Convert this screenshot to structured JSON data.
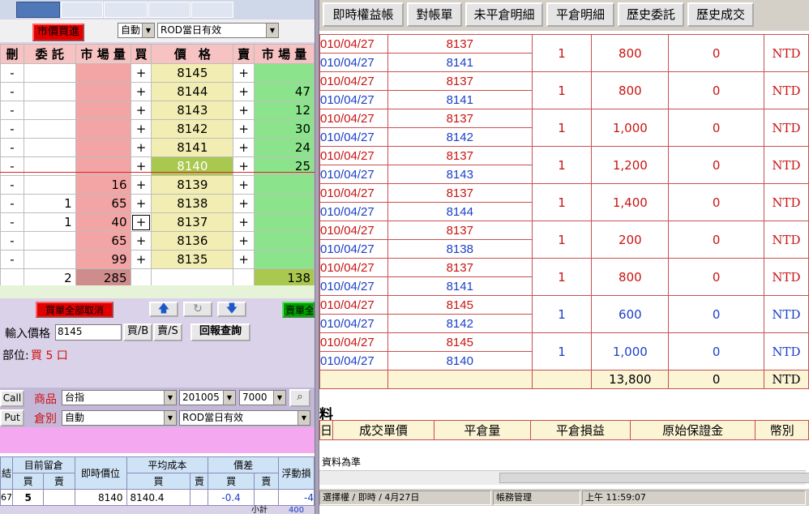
{
  "left": {
    "mkt_order_label": "市價買進",
    "mode_select": "自動",
    "rod_select": "ROD當日有效",
    "headers": [
      "刪",
      "委 託",
      "市 場 量",
      "買",
      "價　格",
      "賣",
      "市 場 量"
    ],
    "rows": [
      {
        "del": "-",
        "order": "",
        "bq": "",
        "b": "+",
        "p": "8145",
        "s": "+",
        "sq": ""
      },
      {
        "del": "-",
        "order": "",
        "bq": "",
        "b": "+",
        "p": "8144",
        "s": "+",
        "sq": "47"
      },
      {
        "del": "-",
        "order": "",
        "bq": "",
        "b": "+",
        "p": "8143",
        "s": "+",
        "sq": "12"
      },
      {
        "del": "-",
        "order": "",
        "bq": "",
        "b": "+",
        "p": "8142",
        "s": "+",
        "sq": "30"
      },
      {
        "del": "-",
        "order": "",
        "bq": "",
        "b": "+",
        "p": "8141",
        "s": "+",
        "sq": "24"
      },
      {
        "del": "-",
        "order": "",
        "bq": "",
        "b": "+",
        "p": "8140",
        "s": "+",
        "sq": "25"
      },
      {
        "del": "-",
        "order": "",
        "bq": "16",
        "b": "+",
        "p": "8139",
        "s": "+",
        "sq": ""
      },
      {
        "del": "-",
        "order": "1",
        "bq": "65",
        "b": "+",
        "p": "8138",
        "s": "+",
        "sq": ""
      },
      {
        "del": "-",
        "order": "1",
        "bq": "40",
        "b": "+",
        "p": "8137",
        "s": "+",
        "sq": ""
      },
      {
        "del": "-",
        "order": "",
        "bq": "65",
        "b": "+",
        "p": "8136",
        "s": "+",
        "sq": ""
      },
      {
        "del": "-",
        "order": "",
        "bq": "99",
        "b": "+",
        "p": "8135",
        "s": "+",
        "sq": ""
      }
    ],
    "totals": {
      "order": "2",
      "bq": "285",
      "sq": "138"
    },
    "cancel_all_buy": "買單全部取消",
    "cancel_all_sell": "賣單全部取消",
    "up_arrow": "🡅",
    "refresh": "↻",
    "down_arrow": "🡇",
    "input_price_label": "輸入價格",
    "input_price_value": "8145",
    "buy_btn": "買/B",
    "sell_btn": "賣/S",
    "report_btn": "回報查詢",
    "position_label": "部位:",
    "position_value": "買 5 口",
    "call_btn": "Call",
    "put_btn": "Put",
    "product_label": "商品",
    "product_value": "台指",
    "month_value": "201005",
    "strike_value": "7000",
    "warehouse_label": "倉別",
    "warehouse_value": "自動",
    "rod2_value": "ROD當日有效",
    "grid_headers1": [
      "結",
      "目前留倉",
      "即時價位",
      "平均成本",
      "價差",
      "浮動損"
    ],
    "grid_headers2": [
      "買",
      "賣",
      "買",
      "賣",
      "買",
      "賣"
    ],
    "grid_row": [
      "67",
      "5",
      "",
      "8140",
      "8140.4",
      "",
      "-0.4",
      "",
      "-4"
    ],
    "grid_bottom": [
      "小計",
      "400"
    ]
  },
  "right": {
    "buttons": [
      "即時權益帳",
      "對帳單",
      "未平倉明細",
      "平倉明細",
      "歷史委託",
      "歷史成交"
    ],
    "rows": [
      {
        "d1": "010/04/27",
        "n1": "8137",
        "d2": "010/04/27",
        "n2": "8141",
        "q": "1",
        "a": "800",
        "z": "0",
        "cur": "NTD",
        "color": "red"
      },
      {
        "d1": "010/04/27",
        "n1": "8137",
        "d2": "010/04/27",
        "n2": "8141",
        "q": "1",
        "a": "800",
        "z": "0",
        "cur": "NTD",
        "color": "red"
      },
      {
        "d1": "010/04/27",
        "n1": "8137",
        "d2": "010/04/27",
        "n2": "8142",
        "q": "1",
        "a": "1,000",
        "z": "0",
        "cur": "NTD",
        "color": "red"
      },
      {
        "d1": "010/04/27",
        "n1": "8137",
        "d2": "010/04/27",
        "n2": "8143",
        "q": "1",
        "a": "1,200",
        "z": "0",
        "cur": "NTD",
        "color": "red"
      },
      {
        "d1": "010/04/27",
        "n1": "8137",
        "d2": "010/04/27",
        "n2": "8144",
        "q": "1",
        "a": "1,400",
        "z": "0",
        "cur": "NTD",
        "color": "red"
      },
      {
        "d1": "010/04/27",
        "n1": "8137",
        "d2": "010/04/27",
        "n2": "8138",
        "q": "1",
        "a": "200",
        "z": "0",
        "cur": "NTD",
        "color": "red"
      },
      {
        "d1": "010/04/27",
        "n1": "8137",
        "d2": "010/04/27",
        "n2": "8141",
        "q": "1",
        "a": "800",
        "z": "0",
        "cur": "NTD",
        "color": "red"
      },
      {
        "d1": "010/04/27",
        "n1": "8145",
        "d2": "010/04/27",
        "n2": "8142",
        "q": "1",
        "a": "600",
        "z": "0",
        "cur": "NTD",
        "color": "blue"
      },
      {
        "d1": "010/04/27",
        "n1": "8145",
        "d2": "010/04/27",
        "n2": "8140",
        "q": "1",
        "a": "1,000",
        "z": "0",
        "cur": "NTD",
        "color": "blue"
      }
    ],
    "total": {
      "a": "13,800",
      "z": "0",
      "cur": "NTD"
    },
    "section_title": "料",
    "cols2": [
      "日",
      "成交單價",
      "平倉量",
      "平倉損益",
      "原始保證金",
      "幣別"
    ],
    "note": "資料為準",
    "status": [
      "選擇權 / 即時 / 4月27日",
      "帳務管理",
      "上午 11:59:07"
    ]
  }
}
